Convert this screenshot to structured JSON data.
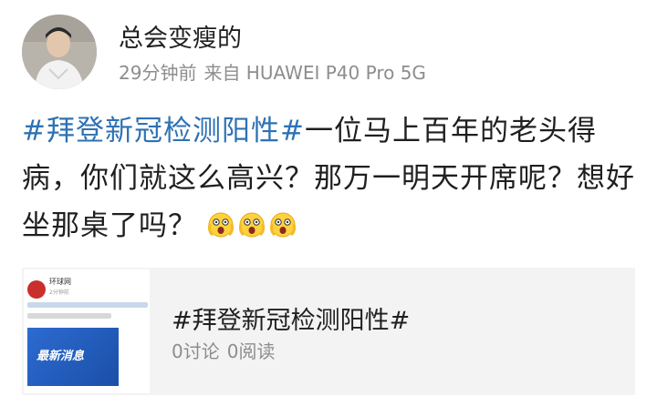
{
  "author": {
    "name": "总会变瘦的"
  },
  "meta": {
    "time": "29分钟前",
    "source": "来自 HUAWEI P40 Pro 5G"
  },
  "post": {
    "topic": "#拜登新冠检测阳性#",
    "body": "一位马上百年的老头得病，你们就这么高兴？那万一明天开席呢？想好坐那桌了吗？",
    "emojis": [
      "scared-face-icon",
      "scared-face-icon",
      "scared-face-icon"
    ]
  },
  "card": {
    "thumb_account": "环球网",
    "thumb_time": "2分钟前",
    "thumb_banner": "最新消息",
    "title": "#拜登新冠检测阳性#",
    "comments": "0讨论",
    "reads": "0阅读"
  },
  "colors": {
    "topic": "#2e72b4",
    "meta": "#8d8d8d",
    "card_bg": "#f3f3f3"
  }
}
